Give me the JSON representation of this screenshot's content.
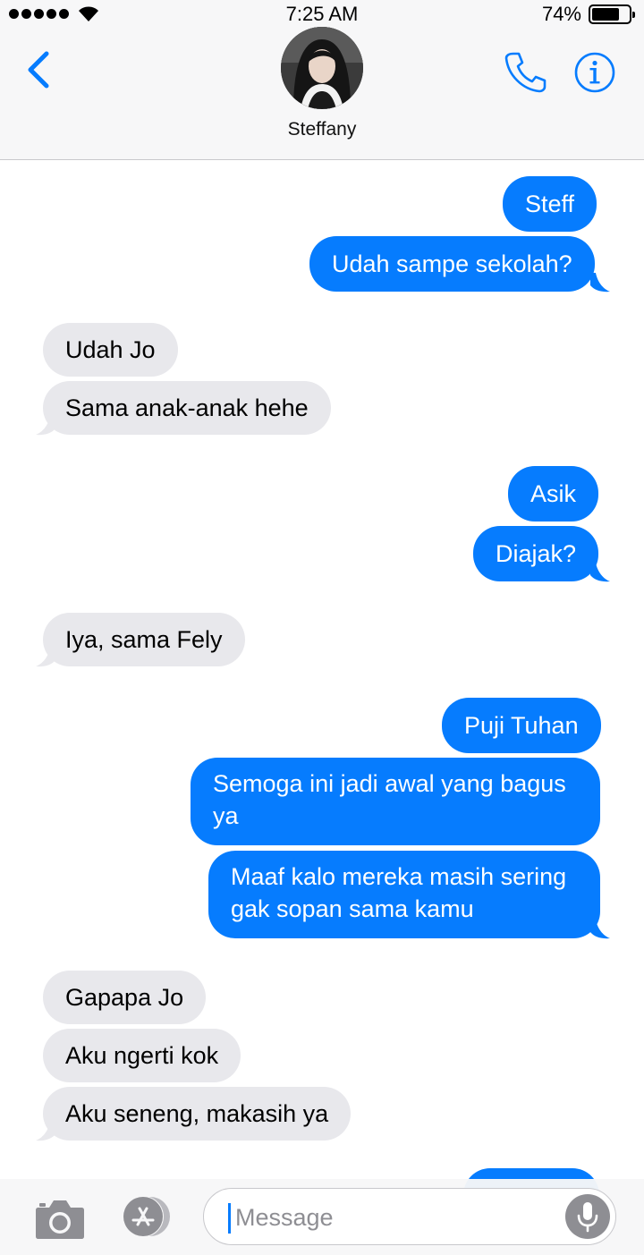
{
  "status_bar": {
    "time": "7:25 AM",
    "battery_percent": "74%",
    "battery_level": 0.74,
    "signal_bars": 5,
    "icons": [
      "signal-dots-icon",
      "wifi-icon",
      "battery-icon"
    ]
  },
  "header": {
    "contact_name": "Steffany",
    "icons": [
      "chevron-left-icon",
      "phone-icon",
      "info-icon"
    ]
  },
  "messages": [
    {
      "side": "sent",
      "text": "Steff"
    },
    {
      "side": "sent",
      "text": "Udah sampe sekolah?"
    },
    {
      "side": "recv",
      "text": "Udah Jo"
    },
    {
      "side": "recv",
      "text": "Sama anak-anak hehe"
    },
    {
      "side": "sent",
      "text": "Asik"
    },
    {
      "side": "sent",
      "text": "Diajak?"
    },
    {
      "side": "recv",
      "text": "Iya, sama Fely"
    },
    {
      "side": "sent",
      "text": "Puji Tuhan"
    },
    {
      "side": "sent",
      "text": "Semoga ini jadi awal yang bagus ya"
    },
    {
      "side": "sent",
      "text": "Maaf kalo mereka masih sering gak sopan sama kamu"
    },
    {
      "side": "recv",
      "text": "Gapapa Jo"
    },
    {
      "side": "recv",
      "text": "Aku ngerti kok"
    },
    {
      "side": "recv",
      "text": "Aku seneng, makasih ya"
    }
  ],
  "input_bar": {
    "placeholder": "Message",
    "icons": [
      "camera-icon",
      "app-store-icon",
      "microphone-icon"
    ]
  },
  "colors": {
    "accent": "#067cfe",
    "sent_bubble": "#067cfe",
    "received_bubble": "#e8e8ec",
    "header_background": "#f7f7f8"
  }
}
